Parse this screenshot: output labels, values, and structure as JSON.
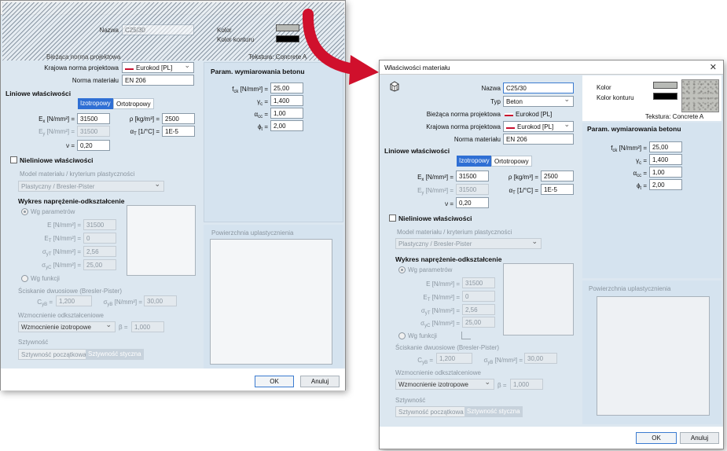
{
  "dialog": {
    "title": "Właściwości materiału",
    "name_label": "Nazwa",
    "name_value": "C25/30",
    "type_label": "Typ",
    "type_value": "Beton",
    "current_norm_label": "Bieżąca norma projektowa",
    "current_norm_value": "Eurokod [PL]",
    "national_norm_label": "Krajowa norma projektowa",
    "national_norm_value": "Eurokod [PL]",
    "material_norm_label": "Norma materiału",
    "material_norm_value": "EN 206",
    "color_label": "Kolor",
    "outline_color_label": "Kolor konturu",
    "texture_label": "Tekstura: Concrete A",
    "colors": {
      "fill": "#b8bab6",
      "outline": "#000000",
      "accent": "#2f6fd4",
      "arrow": "#d0102c"
    }
  },
  "linear": {
    "title": "Liniowe właściwości",
    "tab_iso": "Izotropowy",
    "tab_ortho": "Ortotropowy",
    "ex_label": "[N/mm²] =",
    "ex_value": "31500",
    "ey_label": "[N/mm²] =",
    "ey_value": "31500",
    "rho_label": "ρ [kg/m³] =",
    "rho_value": "2500",
    "alpha_label": "[1/°C] =",
    "alpha_value": "1E-5",
    "nu_label": "ν =",
    "nu_value": "0,20"
  },
  "nonlinear": {
    "title": "Nieliniowe właściwości",
    "model_label": "Model materiału / kryterium plastyczności",
    "model_value": "Plastyczny / Bresler-Pister",
    "curve_title": "Wykres naprężenie-odkształcenie",
    "by_params": "Wg parametrów",
    "e_label": "E [N/mm²] =",
    "e_value": "31500",
    "et_label": "[N/mm²] =",
    "et_value": "0",
    "syt_label": "[N/mm²] =",
    "syt_value": "2,56",
    "syc_label": "[N/mm²] =",
    "syc_value": "25,00",
    "by_function": "Wg funkcji",
    "biaxial_label": "Ściskanie dwuosiowe (Bresler-Pister)",
    "cyb_label": "=",
    "cyb_value": "1,200",
    "syb_label": "[N/mm²] =",
    "syb_value": "30,00",
    "hardening_label": "Wzmocnienie odkształceniowe",
    "hardening_value": "Wzmocnienie izotropowe",
    "beta_label": "β =",
    "beta_value": "1,000",
    "stiffness_label": "Sztywność",
    "stiff_initial": "Sztywność początkowa",
    "stiff_secant": "Sztywność styczna"
  },
  "design": {
    "title": "Param. wymiarowania betonu",
    "fck_label": "[N/mm²] =",
    "fck_value": "25,00",
    "gc_label": "=",
    "gc_value": "1,400",
    "acc_label": "=",
    "acc_value": "1,00",
    "phit_label": "=",
    "phit_value": "2,00"
  },
  "plastic_surface_label": "Powierzchnia uplastycznienia",
  "buttons": {
    "ok": "OK",
    "cancel": "Anuluj"
  }
}
